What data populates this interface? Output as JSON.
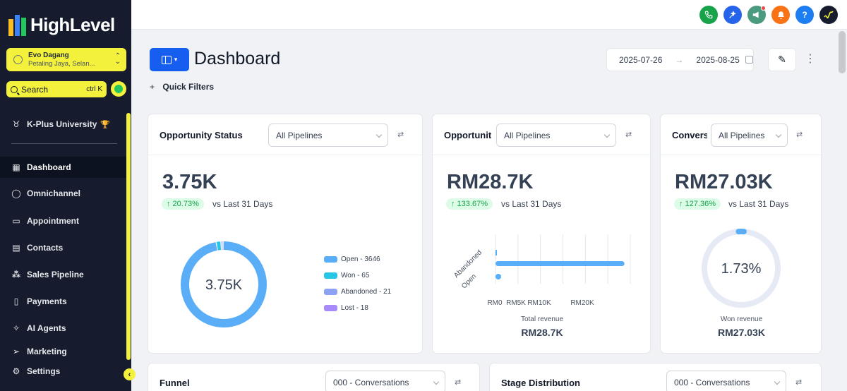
{
  "brand": {
    "name": "HighLevel"
  },
  "account": {
    "name": "Evo Dagang",
    "location": "Petaling Jaya, Selan..."
  },
  "search": {
    "label": "Search",
    "shortcut": "ctrl K"
  },
  "sidebar": {
    "pinned": {
      "label": "K-Plus University",
      "badge": "🏆"
    },
    "items": [
      {
        "label": "Dashboard",
        "icon": "dashboard-icon",
        "active": true
      },
      {
        "label": "Omnichannel",
        "icon": "chat-bubble-icon"
      },
      {
        "label": "Appointment",
        "icon": "calendar-icon"
      },
      {
        "label": "Contacts",
        "icon": "contacts-icon"
      },
      {
        "label": "Sales Pipeline",
        "icon": "pipeline-icon"
      },
      {
        "label": "Payments",
        "icon": "payments-icon"
      },
      {
        "label": "AI Agents",
        "icon": "sparkle-icon"
      },
      {
        "label": "Marketing",
        "icon": "send-icon"
      },
      {
        "label": "Settings",
        "icon": "gear-icon"
      }
    ]
  },
  "topbar": {
    "icons": [
      {
        "name": "phone-icon",
        "color": "#16a34a"
      },
      {
        "name": "magic-icon",
        "color": "#2563eb"
      },
      {
        "name": "megaphone-icon",
        "color": "#4b9b7f"
      },
      {
        "name": "bell-icon",
        "color": "#f97316"
      },
      {
        "name": "help-icon",
        "color": "#1d7df2"
      },
      {
        "name": "profile-avatar-icon",
        "color": "#161c2d"
      }
    ],
    "help_glyph": "?"
  },
  "header": {
    "title": "Dashboard",
    "date_from": "2025-07-26",
    "date_to": "2025-08-25",
    "quick_filters": "Quick Filters"
  },
  "cards": {
    "opportunity_status": {
      "title": "Opportunity Status",
      "pipeline": "All Pipelines",
      "value": "3.75K",
      "change": "↑ 20.73%",
      "vs": "vs Last 31 Days",
      "donut_center": "3.75K",
      "legend": [
        {
          "label": "Open - 3646",
          "value": 3646,
          "color": "#5aaef7"
        },
        {
          "label": "Won - 65",
          "value": 65,
          "color": "#26c6e6"
        },
        {
          "label": "Abandoned - 21",
          "value": 21,
          "color": "#8ea2f5"
        },
        {
          "label": "Lost - 18",
          "value": 18,
          "color": "#a78bfa"
        }
      ]
    },
    "opportunity_value": {
      "title": "Opportunit",
      "pipeline": "All Pipelines",
      "value": "RM28.7K",
      "change": "↑ 133.67%",
      "vs": "vs Last 31 Days",
      "total_label": "Total revenue",
      "total_value": "RM28.7K"
    },
    "conversion": {
      "title": "Convers",
      "pipeline": "All Pipelines",
      "value": "RM27.03K",
      "change": "↑ 127.36%",
      "vs": "vs Last 31 Days",
      "gauge_value": "1.73%",
      "gauge_fraction": 0.0173,
      "won_label": "Won revenue",
      "won_value": "RM27.03K"
    },
    "funnel": {
      "title": "Funnel",
      "select": "000 - Conversations"
    },
    "stage_distribution": {
      "title": "Stage Distribution",
      "select": "000 - Conversations"
    }
  },
  "chart_data": [
    {
      "type": "pie",
      "title": "",
      "categories": [
        "Open",
        "Won",
        "Abandoned",
        "Lost"
      ],
      "values": [
        3646,
        65,
        21,
        18
      ]
    },
    {
      "type": "bar",
      "orientation": "horizontal",
      "categories": [
        "Abandoned",
        "Open"
      ],
      "values": [
        0,
        28700
      ],
      "xticks": [
        "RM0",
        "RM5K",
        "RM10K",
        "RM20K"
      ],
      "xlim": [
        0,
        30000
      ],
      "xlabel": "",
      "ylabel": ""
    }
  ]
}
